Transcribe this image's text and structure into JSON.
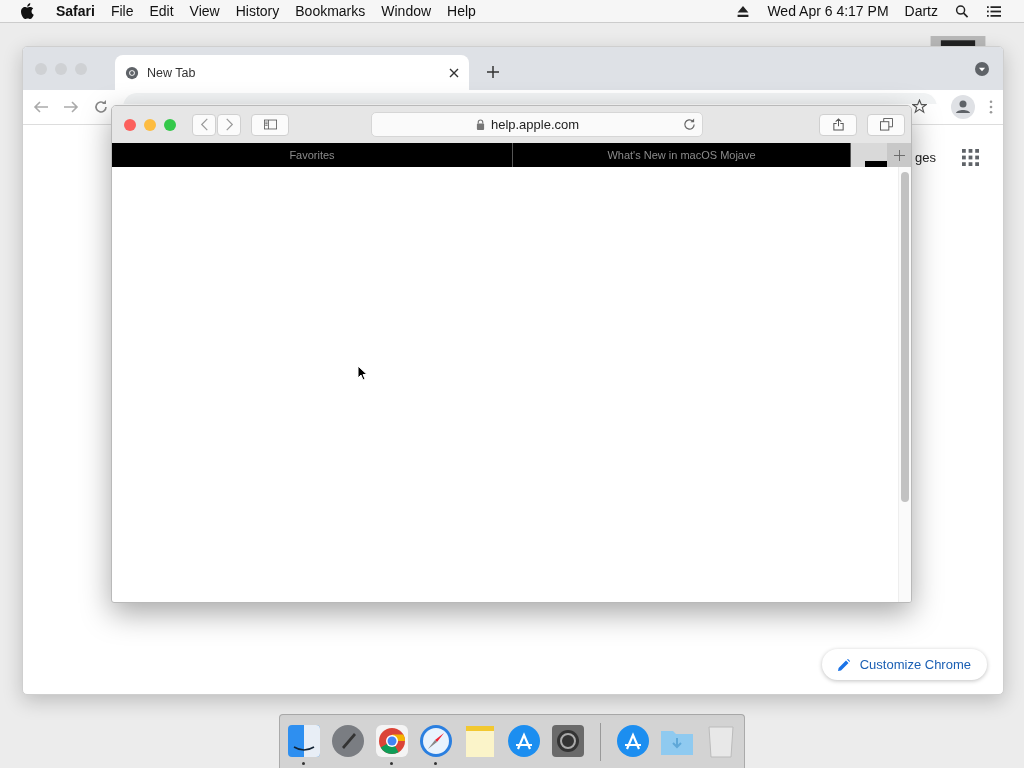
{
  "menu_bar": {
    "app": "Safari",
    "menus": [
      "File",
      "Edit",
      "View",
      "History",
      "Bookmarks",
      "Window",
      "Help"
    ],
    "clock": "Wed Apr 6  4:17 PM",
    "user": "Dartz"
  },
  "chrome": {
    "tab": {
      "title": "New Tab"
    },
    "images_link": "ges",
    "customize_button": "Customize Chrome"
  },
  "safari": {
    "address": "help.apple.com",
    "tabs": [
      {
        "label": "Favorites"
      },
      {
        "label": "What's New in macOS Mojave"
      }
    ]
  },
  "dock": [
    {
      "kind": "finder",
      "running": true
    },
    {
      "kind": "launchpad",
      "running": false
    },
    {
      "kind": "chrome",
      "running": true
    },
    {
      "kind": "safari",
      "running": true
    },
    {
      "kind": "notes",
      "running": false
    },
    {
      "kind": "appstore",
      "running": false
    },
    {
      "kind": "settings",
      "running": false
    },
    {
      "kind": "separator"
    },
    {
      "kind": "appstore",
      "running": false
    },
    {
      "kind": "folder",
      "running": false
    },
    {
      "kind": "trash",
      "running": false
    }
  ]
}
